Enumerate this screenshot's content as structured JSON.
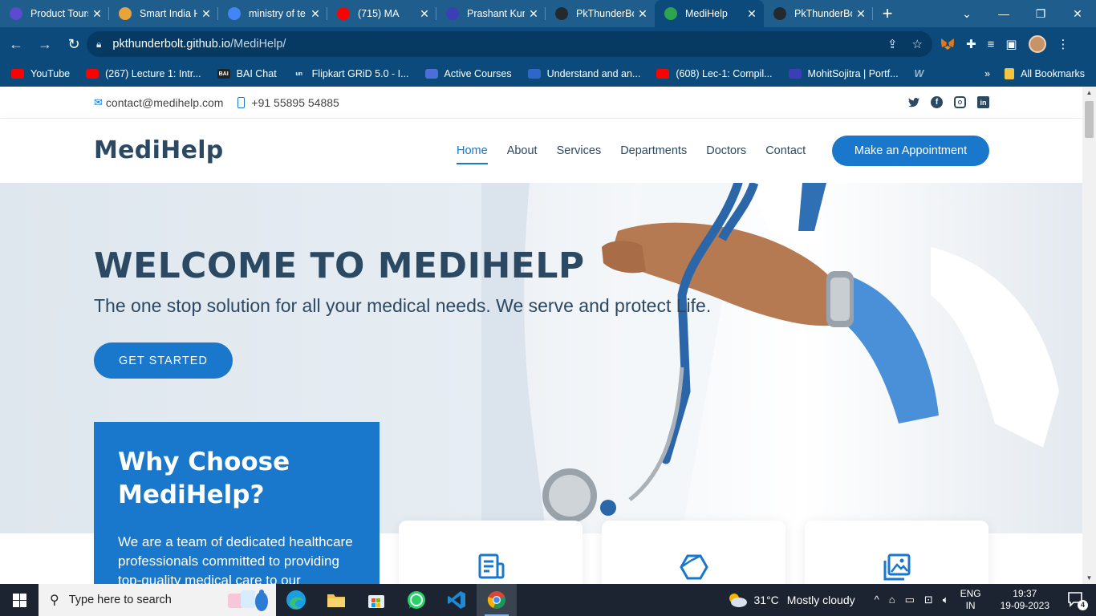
{
  "browser": {
    "tabs": [
      {
        "title": "Product Tours",
        "icon_color": "#5a4bd1",
        "active": false
      },
      {
        "title": "Smart India H",
        "icon_color": "#e8a33b",
        "active": false
      },
      {
        "title": "ministry of te",
        "icon_color": "#4285f4",
        "active": false
      },
      {
        "title": "(715) MA",
        "icon_color": "#ff0000",
        "active": false
      },
      {
        "title": "Prashant Kum",
        "icon_color": "#3a3fb8",
        "active": false
      },
      {
        "title": "PkThunderBo",
        "icon_color": "#24292f",
        "active": false
      },
      {
        "title": "MediHelp",
        "icon_color": "#2ea44f",
        "active": true
      },
      {
        "title": "PkThunderBo",
        "icon_color": "#24292f",
        "active": false
      }
    ],
    "url_host": "pkthunderbolt.github.io",
    "url_path": "/MediHelp/",
    "bookmarks": [
      {
        "label": "YouTube",
        "icon_color": "#ff0000"
      },
      {
        "label": "(267) Lecture 1: Intr...",
        "icon_color": "#ff0000"
      },
      {
        "label": "BAI Chat",
        "icon_color": "#222222",
        "icon_text": "BAI"
      },
      {
        "label": "Flipkart GRiD 5.0 - I...",
        "icon_color": "#0b4a7a",
        "icon_text": "un"
      },
      {
        "label": "Active Courses",
        "icon_color": "#4b6fd6"
      },
      {
        "label": "Understand and an...",
        "icon_color": "#2f67c9"
      },
      {
        "label": "(608) Lec-1: Compil...",
        "icon_color": "#ff0000"
      },
      {
        "label": "MohitSojitra | Portf...",
        "icon_color": "#3a3fb8"
      }
    ],
    "all_bookmarks": "All Bookmarks"
  },
  "site": {
    "email": "contact@medihelp.com",
    "phone": "+91 55895 54885",
    "social": [
      "twitter-icon",
      "facebook-icon",
      "instagram-icon",
      "linkedin-icon"
    ],
    "logo": "MediHelp",
    "nav": [
      "Home",
      "About",
      "Services",
      "Departments",
      "Doctors",
      "Contact"
    ],
    "active_nav": "Home",
    "appointment_button": "Make an Appointment",
    "hero_title": "WELCOME TO MEDIHELP",
    "hero_subtitle": "The one stop solution for all your medical needs. We serve and protect Life.",
    "get_started": "GET STARTED",
    "why_title_line1": "Why Choose",
    "why_title_line2": "MediHelp?",
    "why_text": "We are a team of dedicated healthcare professionals committed to providing top-quality medical care to our",
    "icon_boxes": [
      "receipt-icon",
      "cube-icon",
      "images-icon"
    ],
    "accent_color": "#1977cc",
    "heading_color": "#2c4964"
  },
  "taskbar": {
    "search_placeholder": "Type here to search",
    "weather_temp": "31°C",
    "weather_desc": "Mostly cloudy",
    "lang_line1": "ENG",
    "lang_line2": "IN",
    "time": "19:37",
    "date": "19-09-2023",
    "notifications": "4"
  }
}
